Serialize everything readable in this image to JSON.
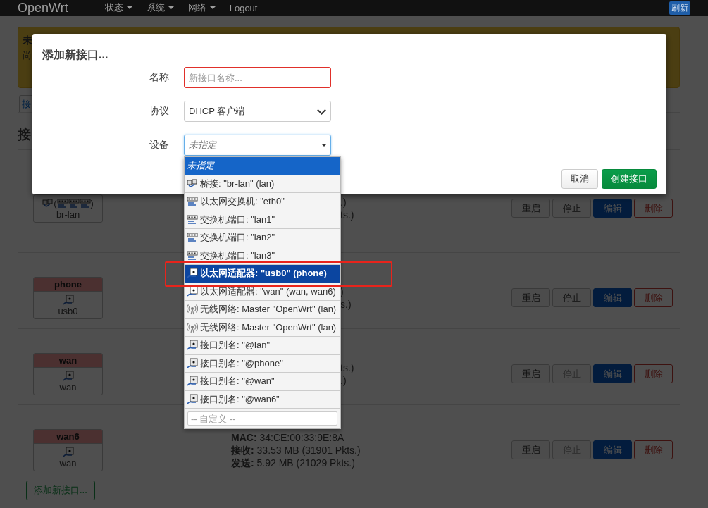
{
  "nav": {
    "brand": "OpenWrt",
    "menus": [
      {
        "label": "状态",
        "dropdown": true
      },
      {
        "label": "系统",
        "dropdown": true
      },
      {
        "label": "网络",
        "dropdown": true
      },
      {
        "label": "Logout",
        "dropdown": false
      }
    ],
    "badge": "刷新"
  },
  "alert": {
    "title": "未",
    "text": "尚"
  },
  "tabs": [
    {
      "label": "接",
      "selected": true
    }
  ],
  "heading": "接",
  "interfaces": [
    {
      "device": {
        "icons": [
          {
            "kind": "bridge"
          }
        ],
        "open": "(",
        "members": [
          {
            "kind": "switch"
          },
          {
            "kind": "switch"
          },
          {
            "kind": "switch"
          }
        ],
        "close": ")",
        "name": "br-lan"
      },
      "stats": [
        ".)",
        "ts.)"
      ],
      "clipped": true,
      "buttons": [
        {
          "label": "重启",
          "kind": "restart",
          "disabled": false
        },
        {
          "label": "停止",
          "kind": "stop",
          "disabled": false
        },
        {
          "label": "编辑",
          "kind": "edit",
          "disabled": false
        },
        {
          "label": "删除",
          "kind": "delete",
          "disabled": false
        }
      ]
    },
    {
      "name": "phone",
      "device": {
        "icons": [
          {
            "kind": "adapter"
          }
        ],
        "name": "usb0"
      },
      "stats": [
        ")",
        "s.)"
      ],
      "clipped": true,
      "buttons": [
        {
          "label": "重启",
          "kind": "restart",
          "disabled": false
        },
        {
          "label": "停止",
          "kind": "stop",
          "disabled": false
        },
        {
          "label": "编辑",
          "kind": "edit",
          "disabled": false
        },
        {
          "label": "删除",
          "kind": "delete",
          "disabled": false
        }
      ]
    },
    {
      "name": "wan",
      "device": {
        "icons": [
          {
            "kind": "adapter"
          }
        ],
        "name": "wan"
      },
      "stats": [
        "ts.)",
        ".)"
      ],
      "clipped": true,
      "buttons": [
        {
          "label": "重启",
          "kind": "restart",
          "disabled": false
        },
        {
          "label": "停止",
          "kind": "stop",
          "disabled": true
        },
        {
          "label": "编辑",
          "kind": "edit",
          "disabled": false
        },
        {
          "label": "删除",
          "kind": "delete",
          "disabled": false
        }
      ]
    },
    {
      "name": "wan6",
      "device": {
        "icons": [
          {
            "kind": "adapter"
          }
        ],
        "name": "wan"
      },
      "stats": [
        "**MAC:** 34:CE:00:33:9E:8A",
        "**接收:** 33.53 MB (31901 Pkts.)",
        "**发送:** 5.92 MB (21029 Pkts.)"
      ],
      "clipped": false,
      "buttons": [
        {
          "label": "重启",
          "kind": "restart",
          "disabled": false
        },
        {
          "label": "停止",
          "kind": "stop",
          "disabled": true
        },
        {
          "label": "编辑",
          "kind": "edit",
          "disabled": false
        },
        {
          "label": "删除",
          "kind": "delete",
          "disabled": false
        }
      ]
    }
  ],
  "add_button": "添加新接口...",
  "modal": {
    "title": "添加新接口...",
    "fields": [
      {
        "label": "名称",
        "kind": "text",
        "placeholder": "新接口名称...",
        "invalid": true
      },
      {
        "label": "协议",
        "kind": "select",
        "value": "DHCP 客户端"
      },
      {
        "label": "设备",
        "kind": "combo",
        "value": "未指定",
        "open": true,
        "custom_placeholder": "-- 自定义 --",
        "options": [
          {
            "label": "未指定",
            "kind": "none",
            "selected": true,
            "highlighted": false,
            "marked": false
          },
          {
            "label": "桥接: \"br-lan\" (lan)",
            "kind": "bridge",
            "selected": false,
            "highlighted": false,
            "marked": false
          },
          {
            "label": "以太网交换机: \"eth0\"",
            "kind": "switch",
            "selected": false,
            "highlighted": false,
            "marked": false
          },
          {
            "label": "交换机端口: \"lan1\"",
            "kind": "switch",
            "selected": false,
            "highlighted": false,
            "marked": false
          },
          {
            "label": "交换机端口: \"lan2\"",
            "kind": "switch",
            "selected": false,
            "highlighted": false,
            "marked": false
          },
          {
            "label": "交换机端口: \"lan3\"",
            "kind": "switch",
            "selected": false,
            "highlighted": false,
            "marked": false
          },
          {
            "label": "以太网适配器: \"usb0\" (phone)",
            "kind": "adapter",
            "selected": false,
            "highlighted": true,
            "marked": true
          },
          {
            "label": "以太网适配器: \"wan\" (wan, wan6)",
            "kind": "adapter",
            "selected": false,
            "highlighted": false,
            "marked": false
          },
          {
            "label": "无线网络: Master \"OpenWrt\" (lan)",
            "kind": "wireless",
            "selected": false,
            "highlighted": false,
            "marked": false
          },
          {
            "label": "无线网络: Master \"OpenWrt\" (lan)",
            "kind": "wireless",
            "selected": false,
            "highlighted": false,
            "marked": false
          },
          {
            "label": "接口别名: \"@lan\"",
            "kind": "alias",
            "selected": false,
            "highlighted": false,
            "marked": false
          },
          {
            "label": "接口别名: \"@phone\"",
            "kind": "alias",
            "selected": false,
            "highlighted": false,
            "marked": false
          },
          {
            "label": "接口别名: \"@wan\"",
            "kind": "alias",
            "selected": false,
            "highlighted": false,
            "marked": false
          },
          {
            "label": "接口别名: \"@wan6\"",
            "kind": "alias",
            "selected": false,
            "highlighted": false,
            "marked": false
          }
        ]
      }
    ],
    "buttons": [
      {
        "label": "取消",
        "kind": "cancel"
      },
      {
        "label": "创建接口",
        "kind": "primary"
      }
    ]
  }
}
